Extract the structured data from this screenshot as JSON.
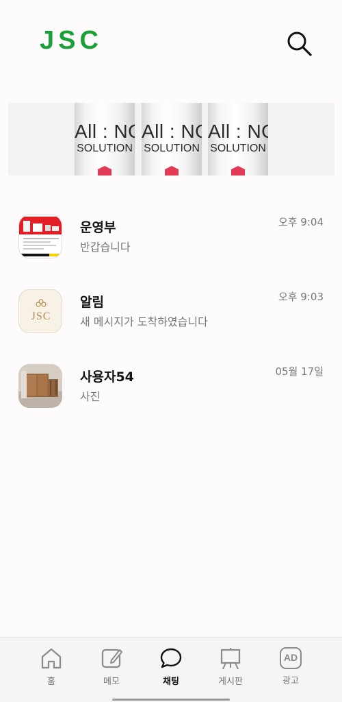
{
  "header": {
    "logo": "JSC",
    "search_icon": "search-icon"
  },
  "banner": {
    "bottles": [
      {
        "line1": "All : NO",
        "line2": "SOLUTION"
      },
      {
        "line1": "All : NO",
        "line2": "SOLUTION"
      },
      {
        "line1": "All : NO",
        "line2": "SOLUTION"
      }
    ]
  },
  "chats": [
    {
      "name": "운영부",
      "message": "반갑습니다",
      "time": "오후 9:04",
      "avatar": "shop-screenshot-thumbnail"
    },
    {
      "name": "알림",
      "message": "새 메시지가 도착하였습니다",
      "time": "오후 9:03",
      "avatar": "jsc-logo-thumbnail",
      "avatar_text": "JSC"
    },
    {
      "name": "사용자54",
      "message": "사진",
      "time": "05월 17일",
      "avatar": "furniture-photo-thumbnail"
    }
  ],
  "nav": {
    "items": [
      {
        "label": "홈",
        "icon": "home-icon"
      },
      {
        "label": "메모",
        "icon": "memo-icon"
      },
      {
        "label": "채팅",
        "icon": "chat-bubble-icon",
        "active": true
      },
      {
        "label": "게시판",
        "icon": "board-easel-icon"
      },
      {
        "label": "광고",
        "icon": "ad-icon",
        "icon_text": "AD"
      }
    ]
  },
  "colors": {
    "brand": "#1aa036",
    "background": "#fdfbfb",
    "muted_text": "#777777"
  }
}
